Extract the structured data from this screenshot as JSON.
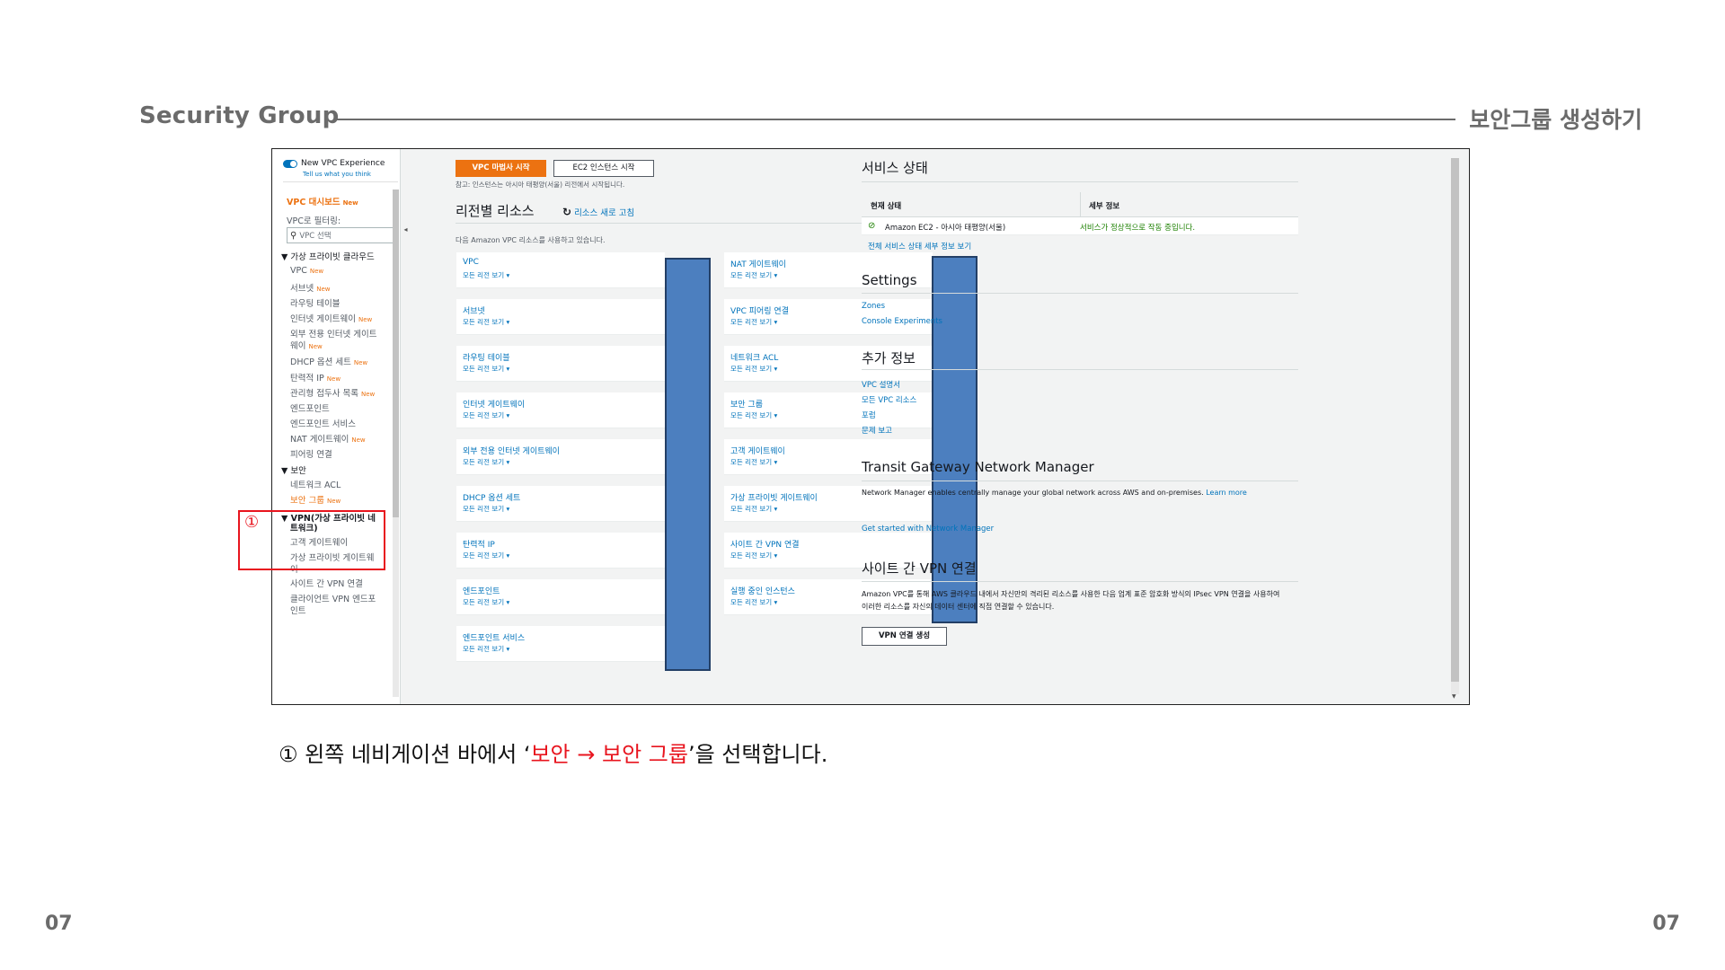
{
  "slide": {
    "title": "Security Group",
    "subtitle": "보안그룹 생성하기",
    "page_left": "07",
    "page_right": "07",
    "caption_prefix": "① 왼쪽 네비게이션 바에서 ‘",
    "caption_highlight": "보안 → 보안 그룹",
    "caption_suffix": "’을 선택합니다.",
    "step_marker": "①"
  },
  "sidebar": {
    "toggle_label": "New VPC Experience",
    "toggle_sub": "Tell us what you think",
    "dashboard": "VPC 대시보드",
    "new_badge": "New",
    "filter_label": "VPC로 필터링:",
    "filter_placeholder": "VPC 선택",
    "section_vpc": "▼ 가상 프라이빗 클라우드",
    "vpc_items": [
      {
        "label": "VPC",
        "new": true
      },
      {
        "label": "서브넷",
        "new": true
      },
      {
        "label": "라우팅 테이블",
        "new": false
      },
      {
        "label": "인터넷 게이트웨이",
        "new": true
      },
      {
        "label": "외부 전용 인터넷 게이트",
        "new": false
      },
      {
        "label": "웨이",
        "new": true
      },
      {
        "label": "DHCP 옵션 세트",
        "new": true
      },
      {
        "label": "탄력적 IP",
        "new": true
      },
      {
        "label": "관리형 접두사 목록",
        "new": true
      },
      {
        "label": "엔드포인트",
        "new": false
      },
      {
        "label": "엔드포인트 서비스",
        "new": false
      },
      {
        "label": "NAT 게이트웨이",
        "new": true
      },
      {
        "label": "피어링 연결",
        "new": false
      }
    ],
    "section_security": "▼ 보안",
    "security_items": [
      {
        "label": "네트워크 ACL",
        "new": false
      },
      {
        "label": "보안 그룹",
        "new": true
      }
    ],
    "section_vpn_line1": "▼ VPN(가상 프라이빗 네",
    "section_vpn_line2": "트워크)",
    "vpn_items": [
      "고객 게이트웨이",
      "가상 프라이빗 게이트웨",
      "이",
      "사이트 간 VPN 연결",
      "클라이언트 VPN 엔드포",
      "인트"
    ]
  },
  "main": {
    "wizard_button": "VPC 마법사 시작",
    "ec2_button": "EC2 인스턴스 시작",
    "note": "참고: 인스턴스는 아시아 태평양(서울) 리전에서 시작됩니다.",
    "region_title": "리전별 리소스",
    "refresh": "리소스 새로 고침",
    "use_note": "다음 Amazon VPC 리소스를 사용하고 있습니다.",
    "all_regions": "모든 리전 보기 ▾",
    "cards_left": [
      "VPC",
      "서브넷",
      "라우팅 테이블",
      "인터넷 게이트웨이",
      "외부 전용 인터넷 게이트웨이",
      "DHCP 옵션 세트",
      "탄력적 IP",
      "엔드포인트",
      "엔드포인트 서비스"
    ],
    "cards_right": [
      "NAT 게이트웨이",
      "VPC 피어링 연결",
      "네트워크 ACL",
      "보안 그룹",
      "고객 게이트웨이",
      "가상 프라이빗 게이트웨이",
      "사이트 간 VPN 연결",
      "실행 중인 인스턴스"
    ]
  },
  "right": {
    "service_title": "서비스 상태",
    "col_status": "현재 상태",
    "col_detail": "세부 정보",
    "row_service": "Amazon EC2 - 아시아 태평양(서울)",
    "row_detail": "서비스가 정상적으로 작동 중입니다.",
    "status_link": "전체 서비스 상태 세부 정보 보기",
    "settings_title": "Settings",
    "settings_links": [
      "Zones",
      "Console Experiments"
    ],
    "info_title": "추가 정보",
    "info_links": [
      "VPC 설명서",
      "모든 VPC 리소스",
      "포럼",
      "문제 보고"
    ],
    "tgw_title": "Transit Gateway Network Manager",
    "tgw_text": "Network Manager enables centrally manage your global network across AWS and on-premises.",
    "tgw_learn": "Learn more",
    "tgw_link": "Get started with Network Manager",
    "vpn_title": "사이트 간 VPN 연결",
    "vpn_text": "Amazon VPC를 통해 AWS 클라우드 내에서 자신만의 격리된 리소스를 사용한 다음 업계 표준 암호화 방식의 IPsec VPN 연결을 사용하여 이러한 리소스를 자신의 데이터 센터에 직접 연결할 수 있습니다.",
    "vpn_button": "VPN 연결 생성"
  },
  "colors": {
    "accent_orange": "#ec7211",
    "link_blue": "#0073bb",
    "highlight_red": "#e8141e",
    "redaction_blue": "#4c7fbf"
  }
}
